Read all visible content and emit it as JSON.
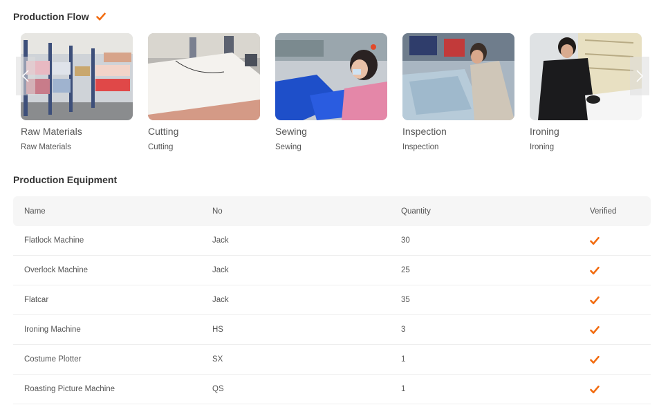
{
  "production_flow": {
    "title": "Production Flow",
    "steps": [
      {
        "name": "Raw Materials",
        "sub": "Raw Materials",
        "photo": "warehouse-shelves-photo"
      },
      {
        "name": "Cutting",
        "sub": "Cutting",
        "photo": "cutting-table-photo"
      },
      {
        "name": "Sewing",
        "sub": "Sewing",
        "photo": "sewing-worker-photo"
      },
      {
        "name": "Inspection",
        "sub": "Inspection",
        "photo": "inspection-worker-photo"
      },
      {
        "name": "Ironing",
        "sub": "Ironing",
        "photo": "ironing-worker-photo"
      }
    ]
  },
  "production_equipment": {
    "title": "Production Equipment",
    "columns": {
      "name": "Name",
      "no": "No",
      "quantity": "Quantity",
      "verified": "Verified"
    },
    "rows": [
      {
        "name": "Flatlock Machine",
        "no": "Jack",
        "quantity": "30",
        "verified": true
      },
      {
        "name": "Overlock Machine",
        "no": "Jack",
        "quantity": "25",
        "verified": true
      },
      {
        "name": "Flatcar",
        "no": "Jack",
        "quantity": "35",
        "verified": true
      },
      {
        "name": "Ironing Machine",
        "no": "HS",
        "quantity": "3",
        "verified": true
      },
      {
        "name": "Costume Plotter",
        "no": "SX",
        "quantity": "1",
        "verified": true
      },
      {
        "name": "Roasting Picture Machine",
        "no": "QS",
        "quantity": "1",
        "verified": true
      }
    ]
  },
  "colors": {
    "accent": "#f26b0f"
  },
  "icons": {
    "verified": "checkmark-icon",
    "prev": "chevron-left-icon",
    "next": "chevron-right-icon"
  }
}
